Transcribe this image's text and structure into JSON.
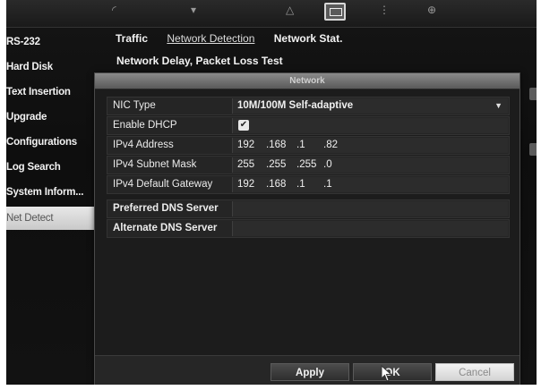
{
  "sidebar": {
    "items": [
      {
        "label": "RS-232"
      },
      {
        "label": "Hard Disk"
      },
      {
        "label": "Text Insertion"
      },
      {
        "label": "Upgrade"
      },
      {
        "label": "Configurations"
      },
      {
        "label": "Log Search"
      },
      {
        "label": "System Inform..."
      },
      {
        "label": "Net Detect"
      }
    ],
    "selected": "Net Detect"
  },
  "tabs": [
    {
      "label": "Traffic"
    },
    {
      "label": "Network Detection",
      "active": true
    },
    {
      "label": "Network Stat."
    }
  ],
  "subtitle": "Network Delay, Packet Loss Test",
  "dialog": {
    "title": "Network",
    "fields": {
      "nic_type": {
        "label": "NIC Type",
        "value": "10M/100M Self-adaptive"
      },
      "enable_dhcp": {
        "label": "Enable DHCP",
        "checked": true,
        "check_glyph": "✔"
      },
      "ipv4_address": {
        "label": "IPv4 Address",
        "octets": [
          "192",
          ".168",
          ".1",
          ".82"
        ]
      },
      "ipv4_subnet_mask": {
        "label": "IPv4 Subnet Mask",
        "octets": [
          "255",
          ".255",
          ".255",
          ".0"
        ]
      },
      "ipv4_default_gateway": {
        "label": "IPv4 Default Gateway",
        "octets": [
          "192",
          ".168",
          ".1",
          ".1"
        ]
      },
      "preferred_dns": {
        "label": "Preferred DNS Server",
        "value": ""
      },
      "alternate_dns": {
        "label": "Alternate DNS Server",
        "value": ""
      }
    },
    "buttons": {
      "apply": "Apply",
      "ok": "OK",
      "cancel": "Cancel"
    }
  },
  "icons": {
    "dropdown": "chevron-down-icon",
    "active_toolbar": "monitor-icon"
  },
  "colors": {
    "background": "#121212",
    "dialog_title_bar": "#707070",
    "selected_item": "#d8d8d8"
  }
}
